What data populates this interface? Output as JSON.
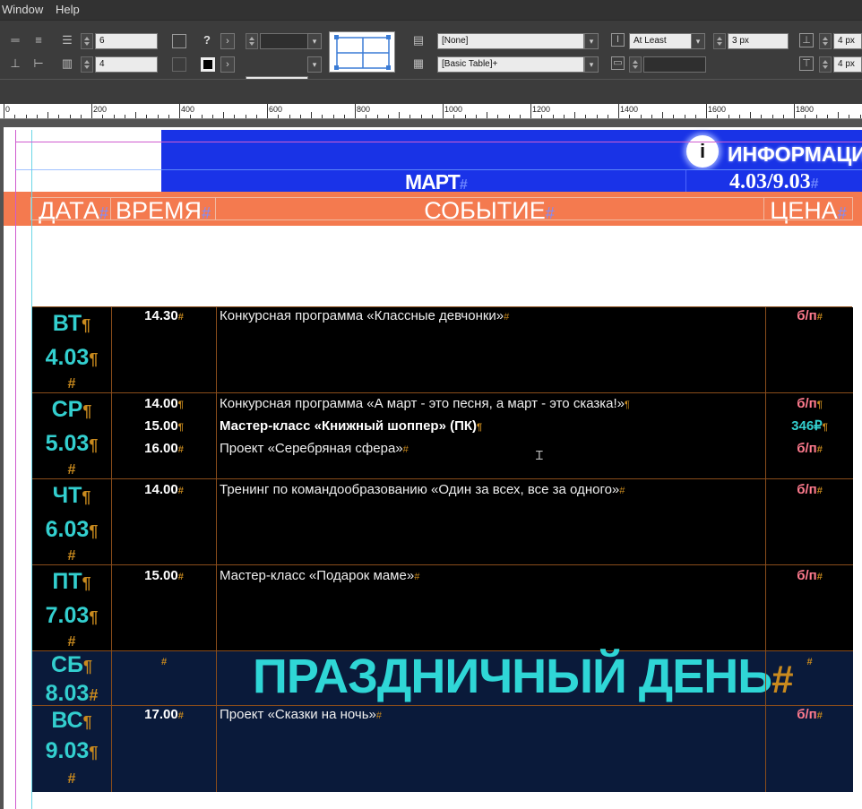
{
  "menu": {
    "window": "Window",
    "help": "Help"
  },
  "controls": {
    "rows": "6",
    "columns": "4",
    "cell_style": "[None]",
    "table_style": "[Basic Table]+",
    "row_height_mode": "At Least",
    "row_height": "3 px",
    "inset_top": "4 px",
    "inset_bottom": "4 px",
    "question": "?",
    "arrow": "›"
  },
  "ruler": {
    "labels": [
      "0",
      "200",
      "400",
      "600",
      "800",
      "1000",
      "1200",
      "1400",
      "1600",
      "1800"
    ]
  },
  "banner": {
    "info_icon": "i",
    "info_text": "ИНФОРМАЦИ",
    "month": "МАРТ",
    "dates": "4.03/9.03"
  },
  "header": {
    "date": "ДАТА",
    "time": "ВРЕМЯ",
    "event": "СОБЫТИЕ",
    "price": "ЦЕНА"
  },
  "marks": {
    "hash": "#",
    "pilcrow": "¶"
  },
  "rows": [
    {
      "day": "ВТ",
      "date": "4.03",
      "lines": [
        {
          "time": "14.30",
          "event": "Конкурсная программа «Классные девчонки»",
          "price": "б/п",
          "bold": false
        }
      ]
    },
    {
      "day": "СР",
      "date": "5.03",
      "lines": [
        {
          "time": "14.00",
          "event": "Конкурсная программа «А март - это песня, а март - это сказка!»",
          "price": "б/п",
          "bold": false
        },
        {
          "time": "15.00",
          "event": "Мастер-класс «Книжный шоппер» (ПК)",
          "price": "346₽",
          "bold": true
        },
        {
          "time": "16.00",
          "event": "Проект «Серебряная сфера»",
          "price": "б/п",
          "bold": false
        }
      ]
    },
    {
      "day": "ЧТ",
      "date": "6.03",
      "lines": [
        {
          "time": "14.00",
          "event": "Тренинг по командообразованию «Один за всех, все за одного»",
          "price": "б/п",
          "bold": false
        }
      ]
    },
    {
      "day": "ПТ",
      "date": "7.03",
      "lines": [
        {
          "time": "15.00",
          "event": "Мастер-класс «Подарок маме»",
          "price": "б/п",
          "bold": false
        }
      ]
    },
    {
      "day": "СБ",
      "date": "8.03",
      "holiday": "ПРАЗДНИЧНЫЙ ДЕНЬ"
    },
    {
      "day": "ВС",
      "date": "9.03",
      "lines": [
        {
          "time": "17.00",
          "event": "Проект «Сказки на ночь»",
          "price": "б/п",
          "bold": false
        }
      ]
    }
  ],
  "colors": {
    "accent_blue": "#1933e6",
    "header_orange": "#f47a4f",
    "day_teal": "#33cfcf",
    "price_pink": "#ff7b8e",
    "table_black": "#000000",
    "weekend_navy": "#0a1a3a"
  }
}
